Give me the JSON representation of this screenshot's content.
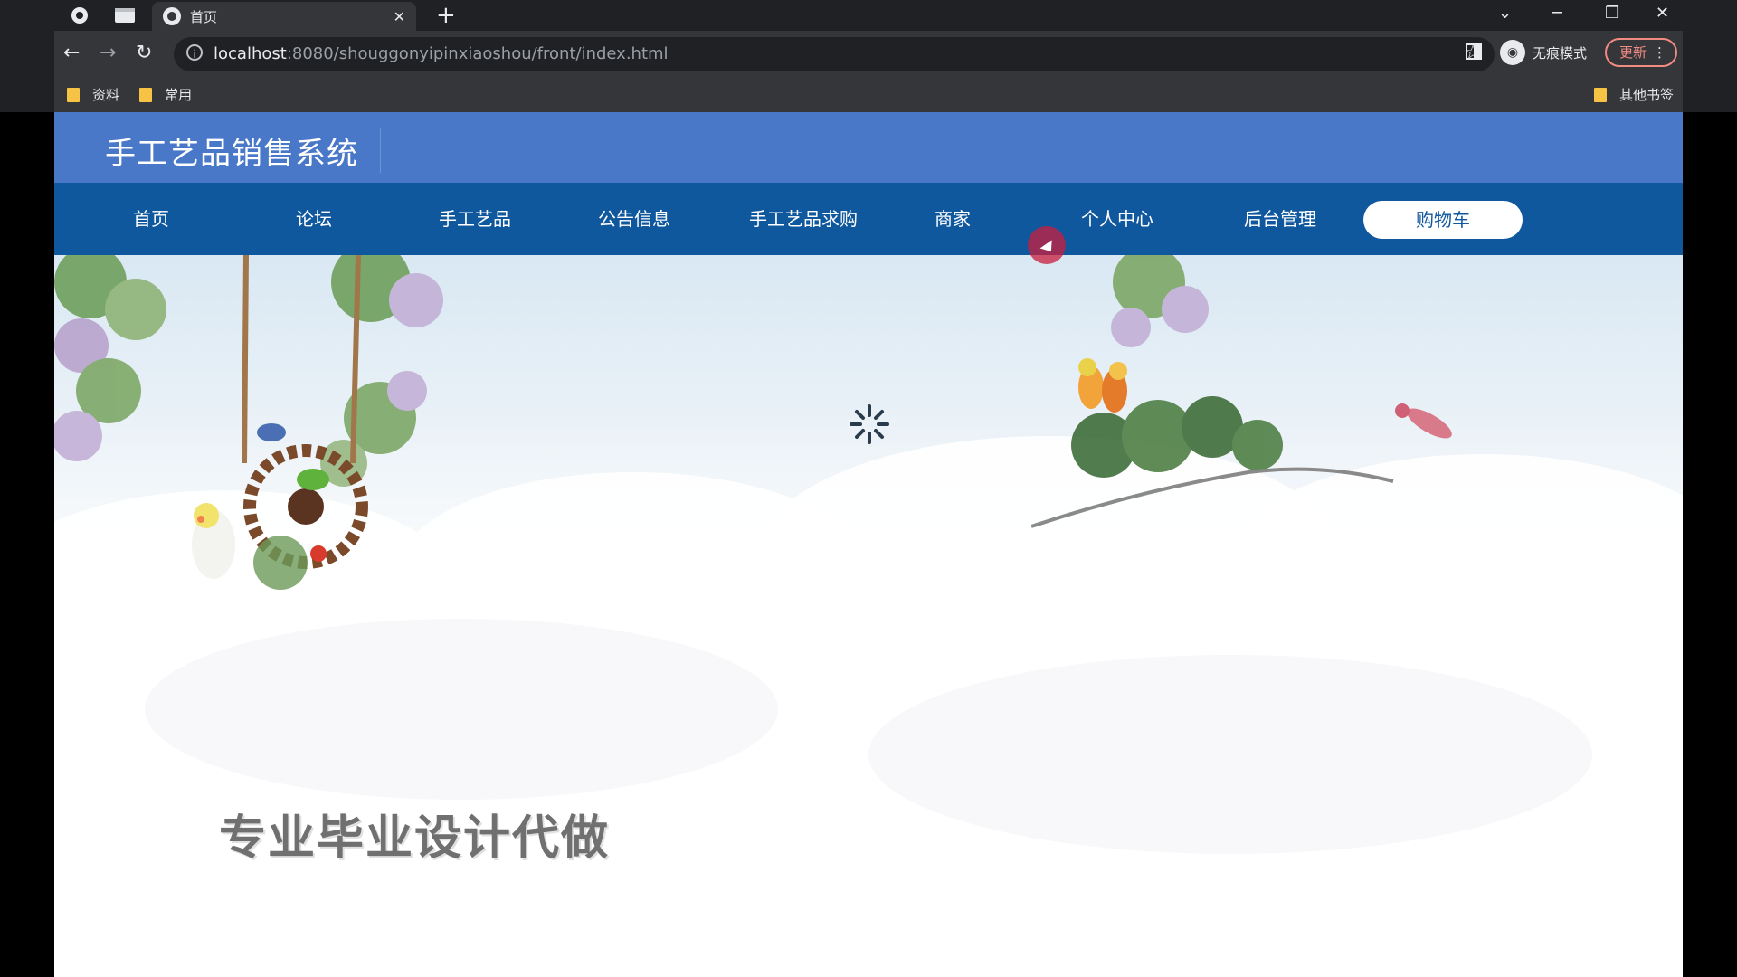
{
  "browser": {
    "tab_title": "首页",
    "url_host": "localhost",
    "url_rest": ":8080/shouggonyipinxiaoshou/front/index.html",
    "incognito_label": "无痕模式",
    "update_label": "更新",
    "bookmarks": [
      "资料",
      "常用"
    ],
    "other_bookmarks": "其他书签"
  },
  "site": {
    "title": "手工艺品销售系统",
    "nav": [
      "首页",
      "论坛",
      "手工艺品",
      "公告信息",
      "手工艺品求购",
      "商家",
      "个人中心",
      "后台管理"
    ],
    "cart_label": "购物车",
    "slogan": "专业毕业设计代做"
  },
  "colors": {
    "header_bg": "#4a78c8",
    "nav_bg": "#10589e",
    "chrome_bg": "#35363a",
    "update_accent": "#f28b82"
  }
}
